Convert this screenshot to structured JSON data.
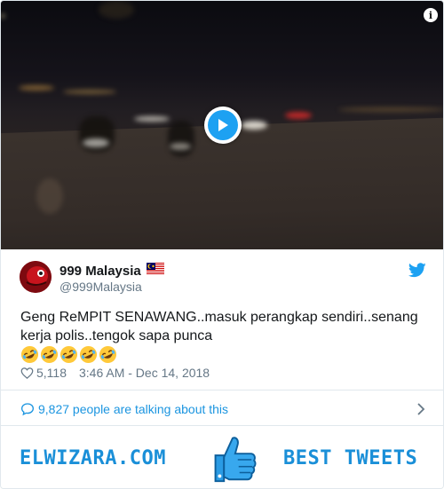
{
  "video": {
    "info_icon": "info-icon",
    "play_icon": "play-icon"
  },
  "tweet": {
    "display_name": "999 Malaysia",
    "flag": "malaysia-flag-icon",
    "handle": "@999Malaysia",
    "text": "Geng ReMPIT SENAWANG..masuk perangkap sendiri..senang kerja polis..tengok sapa punca",
    "emoji_count": 5,
    "emoji_name": "rolling-on-the-floor-laughing-emoji",
    "likes": "5,118",
    "timestamp": "3:46 AM - Dec 14, 2018",
    "talking": "9,827 people are talking about this"
  },
  "banner": {
    "left_text": "ELWIZARA.COM",
    "right_text": "BEST TWEETS",
    "icon": "thumbs-up-icon"
  },
  "colors": {
    "twitter_blue": "#1da1f2",
    "link_blue": "#1b95e0",
    "banner_blue": "#1a8fd8",
    "muted": "#657786"
  }
}
